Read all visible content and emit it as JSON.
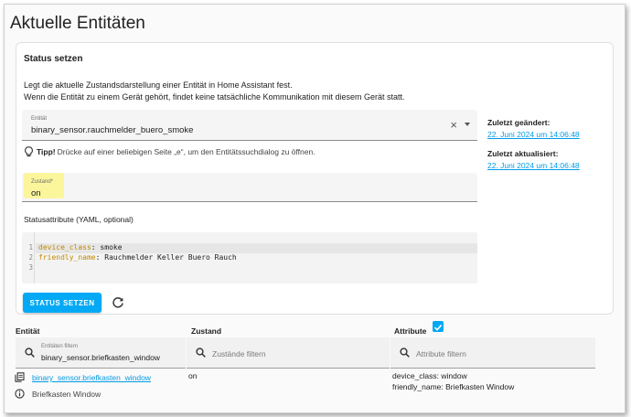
{
  "page": {
    "title": "Aktuelle Entitäten"
  },
  "card": {
    "title": "Status setzen",
    "description_line1": "Legt die aktuelle Zustandsdarstellung einer Entität in Home Assistant fest.",
    "description_line2": "Wenn die Entität zu einem Gerät gehört, findet keine tatsächliche Kommunikation mit diesem Gerät statt.",
    "entity_label": "Entität",
    "entity_value": "binary_sensor.rauchmelder_buero_smoke",
    "tip_strong": "Tipp!",
    "tip_text": "Drücke auf einer beliebigen Seite „e“, um den Entitätssuchdialog zu öffnen.",
    "state_label": "Zustand*",
    "state_value": "on",
    "attributes_title": "Statusattribute (YAML, optional)",
    "code_lines": [
      {
        "number": "1",
        "key": "device_class",
        "value": ": smoke"
      },
      {
        "number": "2",
        "key": "friendly_name",
        "value": ": Rauchmelder Keller Buero Rauch"
      },
      {
        "number": "3",
        "key": "",
        "value": ""
      }
    ],
    "set_button": "STATUS SETZEN",
    "last_changed_label": "Zuletzt geändert:",
    "last_changed_value": "22. Juni 2024 um 14:06:48",
    "last_updated_label": "Zuletzt aktualisiert:",
    "last_updated_value": "22. Juni 2024 um 14:06:48"
  },
  "table": {
    "col_entity": "Entität",
    "col_state": "Zustand",
    "col_attributes": "Attribute",
    "filter_entity_label": "Entitäten filtern",
    "filter_entity_value": "binary_sensor.briefkasten_window",
    "filter_state_placeholder": "Zustände filtern",
    "filter_attr_placeholder": "Attribute filtern",
    "rows": [
      {
        "entity_id": "binary_sensor.briefkasten_window",
        "friendly_name": "Briefkasten Window",
        "state": "on",
        "attr1": "device_class: window",
        "attr2": "friendly_name: Briefkasten Window"
      }
    ]
  },
  "colors": {
    "accent": "#03a9f4",
    "link": "#039be5",
    "highlight": "#fbf59c"
  }
}
